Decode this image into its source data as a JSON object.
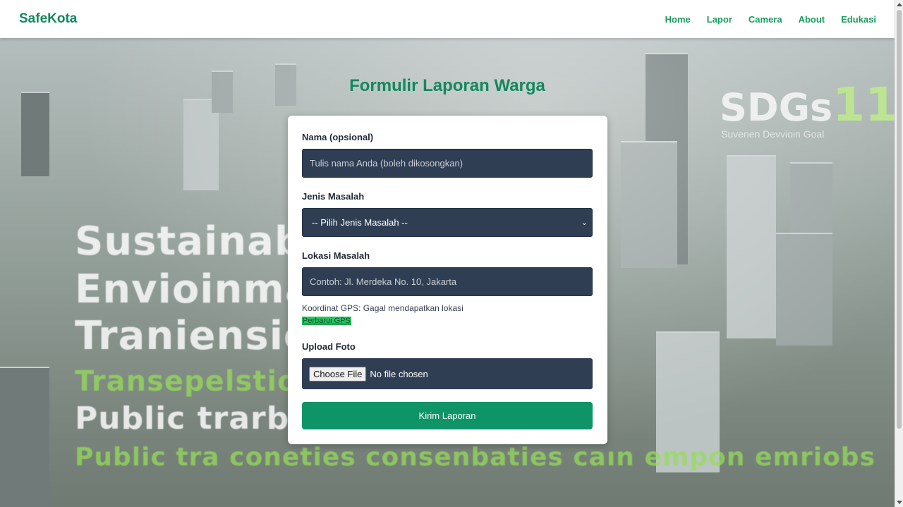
{
  "nav": {
    "brand": "SafeKota",
    "links": [
      "Home",
      "Lapor",
      "Camera",
      "About",
      "Edukasi"
    ]
  },
  "background": {
    "lines": [
      "Sustainable City",
      "Envioinmamt",
      "Traniensiovity",
      "Transepelstion",
      "Public trarbatl",
      "Public tra coneties consenbaties caın empon emriobs"
    ],
    "logo_text": "SDGs",
    "logo_number": "11",
    "logo_sub": "Suvenen Devvioin Goal"
  },
  "form": {
    "title": "Formulir Laporan Warga",
    "name_label": "Nama (opsional)",
    "name_placeholder": "Tulis nama Anda (boleh dikosongkan)",
    "issue_label": "Jenis Masalah",
    "issue_selected": "-- Pilih Jenis Masalah --",
    "location_label": "Lokasi Masalah",
    "location_placeholder": "Contoh: Jl. Merdeka No. 10, Jakarta",
    "gps_status": "Koordinat GPS: Gagal mendapatkan lokasi",
    "gps_refresh": "Perbarui GPS",
    "upload_label": "Upload Foto",
    "file_button": "Choose File",
    "file_status": "No file chosen",
    "submit": "Kirim Laporan"
  },
  "colors": {
    "brand": "#13885e",
    "field_bg": "#2f3e53",
    "submit_bg": "#0e9466"
  }
}
